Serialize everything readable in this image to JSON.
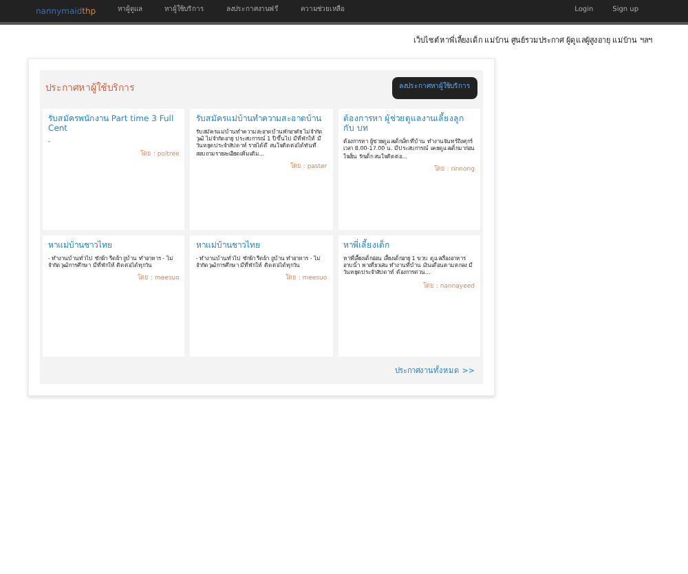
{
  "navbar": {
    "logo": [
      "nannymaid",
      "thp"
    ],
    "links": [
      "หาผู้ดูแล",
      "หาผู้ใช้บริการ",
      "ลงประกาศงานฟรี",
      "ความช่วยเหลือ"
    ],
    "account_links": [
      "Login",
      "Sign up"
    ]
  },
  "tagline": "เว็บไซต์หาพี่เลี้ยงเด็ก แม่บ้าน ศูนย์รวมประกาศ ผู้ดูแลผู้สูงอายุ แม่บ้าน ฯลฯ",
  "panel": {
    "title": "ประกาศหาผู้ใช้บริการ",
    "button": "ลงประกาศหาผู้ใช้บริการ",
    "cards": [
      {
        "title": "รับสมัครพนักงาน Part time 3 Full Cent",
        "description": "-",
        "author": "โดย : poltree"
      },
      {
        "title": "รับสมัครแม่บ้านทำความสะอาดบ้าน",
        "description": "รับสมัครแม่บ้านทำความสะอาดบ้านพักอาศัย ไม่จำกัดวุฒิ ไม่จำกัดอายุ ประสบการณ์ 1 ปีขึ้นไป มีที่พักให้ มีวันหยุดประจำสัปดาห์ รายได้ดี สนใจติดต่อได้ทันที สอบถามรายละเอียดเพิ่มเติม...",
        "author": "โดย : paster"
      },
      {
        "title": "ต้องการหา ผู้ช่วยดูแลงานเลี้ยงลูก กับ บท",
        "description": "ต้องการหา ผู้ช่วยดูแลเด็กเล็ก ที่บ้าน ทำงานจันทร์ถึงศุกร์ เวลา 8.00-17.00 น. มีประสบการณ์ เคยดูแลเด็กมาก่อน ใจเย็น รักเด็ก สนใจติดต่อ...",
        "author": "โดย : rinnong"
      },
      {
        "title": "หาแม่บ้านชาวไทย",
        "description": "- ทำงานบ้านทั่วไป ซักผ้า รีดผ้า ถูบ้าน ทำอาหาร - ไม่จำกัดวุฒิการศึกษา มีที่พักให้ ติดต่อได้ทุกวัน",
        "author": "โดย : meesuo"
      },
      {
        "title": "หาแม่บ้านชาวไทย",
        "description": "- ทำงานบ้านทั่วไป ซักผ้า รีดผ้า ถูบ้าน ทำอาหาร - ไม่จำกัดวุฒิการศึกษา มีที่พักให้ ติดต่อได้ทุกวัน",
        "author": "โดย : meesuo"
      },
      {
        "title": "หาพี่เลี้ยงเด็ก",
        "description": "หาพี่เลี้ยงเด็กอ่อน เลี้ยงเด็กอายุ 1 ขวบ ดูแลเรื่องอาหาร อาบน้ำ พาเที่ยวเล่น ทำงานที่บ้าน เงินเดือนตามตกลง มีวันหยุดประจำสัปดาห์ ต้องการด่วน...",
        "author": "โดย : nannayeed"
      }
    ],
    "more_link": "ประกาศงานทั้งหมด >>"
  }
}
